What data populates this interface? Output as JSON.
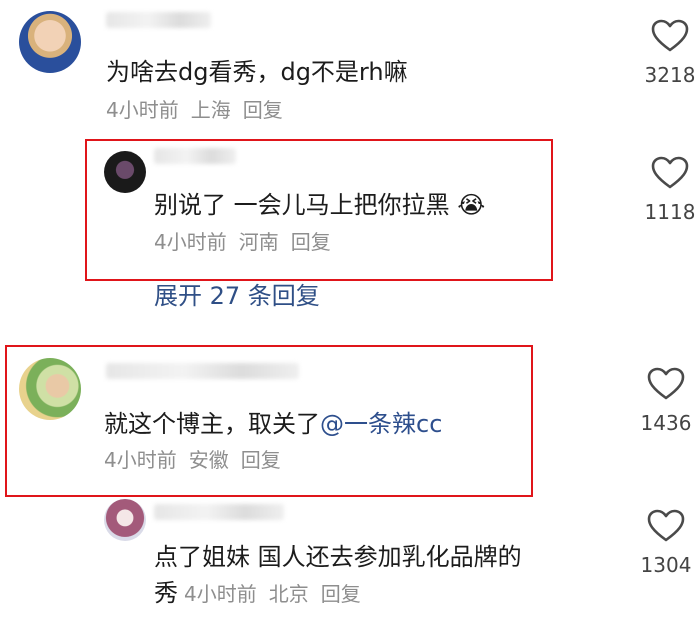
{
  "comments": [
    {
      "text": "为啥去dg看秀，dg不是rh嘛",
      "time": "4小时前",
      "location": "上海",
      "reply_label": "回复",
      "likes": "3218",
      "icon": "heart-outline-icon"
    },
    {
      "text": "别说了 一会儿马上把你拉黑",
      "emoji": "😭",
      "time": "4小时前",
      "location": "河南",
      "reply_label": "回复",
      "likes": "1118",
      "icon": "heart-outline-icon"
    },
    {
      "text": "就这个博主，取关了",
      "mention": "@一条辣cc",
      "time": "4小时前",
      "location": "安徽",
      "reply_label": "回复",
      "likes": "1436",
      "icon": "heart-outline-icon"
    },
    {
      "text_line1": "点了姐妹 国人还去参加乳化品牌的",
      "text_line2": "秀",
      "time": "4小时前",
      "location": "北京",
      "reply_label": "回复",
      "likes": "1304",
      "icon": "heart-outline-icon"
    }
  ],
  "expand_replies": "展开 27 条回复",
  "colors": {
    "highlight_border": "#e0151a",
    "link": "#2f4f86",
    "meta": "#8e8e8e"
  }
}
